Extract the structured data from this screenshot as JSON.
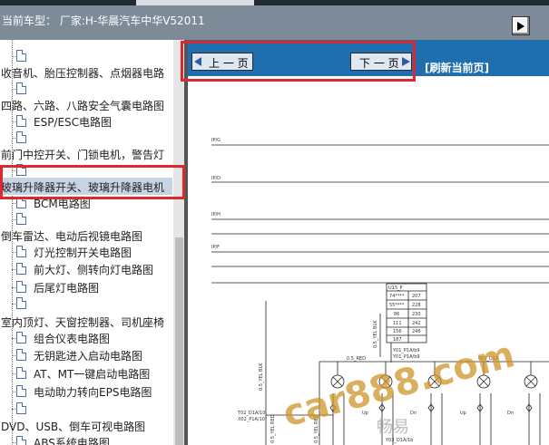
{
  "header": {
    "title": "当前车型： 厂家:H-华晨汽车中华V52011"
  },
  "sidebar": {
    "items": [
      {
        "label": ""
      },
      {
        "label": "收音机、胎压控制器、点烟器电路"
      },
      {
        "label": ""
      },
      {
        "label": "四路、六路、八路安全气囊电路图"
      },
      {
        "label": "ESP/ESC电路图"
      },
      {
        "label": ""
      },
      {
        "label": "前门中控开关、门锁电机，警告灯"
      },
      {
        "label": ""
      },
      {
        "label": "玻璃升降器开关、玻璃升降器电机"
      },
      {
        "label": "BCM电路图"
      },
      {
        "label": ""
      },
      {
        "label": "倒车雷达、电动后视镜电路图"
      },
      {
        "label": "灯光控制开关电路图"
      },
      {
        "label": "前大灯、侧转向灯电路图"
      },
      {
        "label": "后尾灯电路图"
      },
      {
        "label": ""
      },
      {
        "label": "室内顶灯、天窗控制器、司机座椅"
      },
      {
        "label": "组合仪表电路图"
      },
      {
        "label": "无钥匙进入启动电路图"
      },
      {
        "label": "AT、MT一键启动电路图"
      },
      {
        "label": "电动助力转向EPS电路图"
      },
      {
        "label": ""
      },
      {
        "label": "DVD、USB、倒车可视电路图"
      },
      {
        "label": "ABS系统电路图"
      }
    ]
  },
  "toolbar": {
    "prev_label": "上 一 页",
    "next_label": "下 一 页",
    "refresh_label": "[刷新当前页]"
  },
  "diagram": {
    "bus_labels": [
      "IP/G",
      "IP/D",
      "IP/H",
      "IP/F"
    ],
    "table_title": "U15_P",
    "table_rows": [
      [
        "74****",
        "207"
      ],
      [
        "55****",
        "228"
      ],
      [
        "86",
        "230"
      ],
      [
        "111",
        "242"
      ],
      [
        "156",
        "246"
      ],
      [
        "187",
        ""
      ]
    ],
    "wire_labels": {
      "left_vertical": "0.5_YEL BLK",
      "connector": "Y01_P1A/b9",
      "connector2": "Y01_P1A/b9",
      "red": "0.5_RED",
      "red2": "0.5_RED",
      "d01": "001_D1A",
      "yel_vertical": "0.5_YEL BLK",
      "t02": "T02_D1A/10",
      "x02": "X02_P1A/10",
      "bottom": "Y03_D1A/1b",
      "yel_red": "0.5_YEL RED",
      "yel_red2": "0.5_YEL RED"
    },
    "lamp_labels": [
      "Up",
      "Dn",
      "Up",
      "Dn",
      "Up",
      "Dn",
      "Up",
      "Dn"
    ],
    "watermark": "car888.com",
    "watermark_cn": "畅易"
  },
  "colors": {
    "titlebar": "#7d8a98",
    "navbar": "#1f6fae",
    "highlight": "#e0282c",
    "selected_row": "#c6d4e6"
  },
  "icons": {
    "collapse": "collapse-panel-icon",
    "prev": "left-arrow-icon",
    "next": "right-arrow-icon",
    "doc": "document-icon"
  }
}
